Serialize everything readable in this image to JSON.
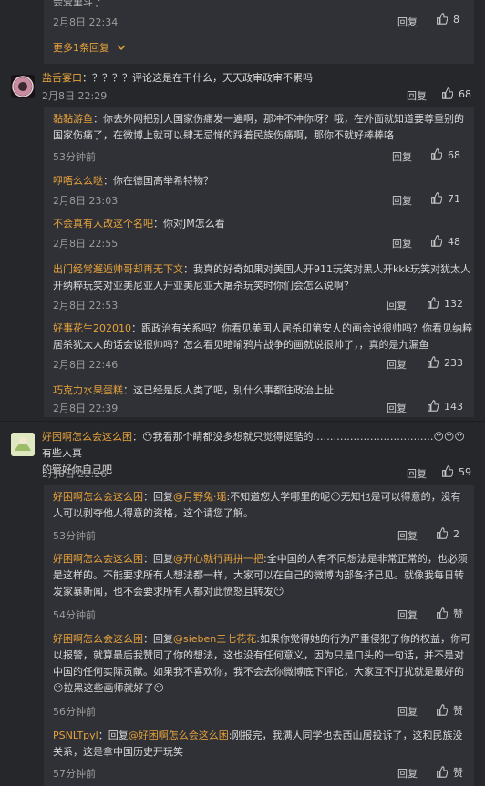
{
  "top": {
    "partial_text": "会爱里斗了",
    "time": "2月8日 22:34",
    "reply_label": "回复",
    "likes": "8",
    "more_replies": "更多1条回复"
  },
  "comment1": {
    "user": "盐舌宴口",
    "text": "：？？？？评论这是在干什么，天天政审政审不累吗",
    "time": "2月8日 22:29",
    "reply_label": "回复",
    "likes": "68",
    "replies": [
      {
        "user": "黏黏游鱼",
        "text1": "：你去外网把别人国家伤痛发一遍啊，那冲不冲你呀？哦，在外面就知道要尊重别的",
        "text2": "国家伤痛了，在微博上就可以肆无忌惮的踩着民族伤痛啊，那你不就好棒棒咯",
        "time": "53分钟前",
        "reply_label": "回复",
        "likes": "68"
      },
      {
        "user": "咿唔么么哒",
        "text1": "：你在德国高举希特物？",
        "time": "2月8日 23:03",
        "reply_label": "回复",
        "likes": "71"
      },
      {
        "user": "不会真有人改这个名吧",
        "text1": "：你对JM怎么看",
        "time": "2月8日 22:55",
        "reply_label": "回复",
        "likes": "48"
      },
      {
        "user": "出门经常邂逅帅哥却再无下文",
        "text1": "：我真的好奇如果对美国人开911玩笑对黑人开kkk玩笑对犹太人",
        "text2": "开纳粹玩笑对亚美尼亚人开亚美尼亚大屠杀玩笑时你们会怎么说啊？",
        "time": "2月8日 22:53",
        "reply_label": "回复",
        "likes": "132"
      },
      {
        "user": "好事花生202010",
        "text1": "：跟政治有关系吗？你看见美国人居杀印第安人的画会说很帅吗？你看见纳粹",
        "text2": "居杀犹太人的话会说很帅吗？怎么看见暗喻鸦片战争的画就说很帅了，，真的是九漏鱼",
        "time": "2月8日 22:46",
        "reply_label": "回复",
        "likes": "233"
      },
      {
        "user": "巧克力水果蛋糕",
        "text1": "：这已经是反人类了吧，别什么事都往政治上扯",
        "time": "2月8日 22:39",
        "reply_label": "回复",
        "likes": "143"
      }
    ]
  },
  "comment2": {
    "user": "好困啊怎么会这么困",
    "text1": "：😶我看那个睛都没多想就只觉得挺酷的………………………………😶😶😶 有些人真",
    "text2": "的管好你自己吧",
    "time": "2月8日 22:26",
    "reply_label": "回复",
    "likes": "59",
    "replies": [
      {
        "user": "好困啊怎么会这么困",
        "pre": "：回复",
        "mention": "@月野兔·瑶",
        "text1": ":不知道您大学哪里的呢😶无知也是可以得意的，没有",
        "text2": "人可以剥夺他人得意的资格，这个请您了解。",
        "time": "53分钟前",
        "reply_label": "回复",
        "likes": "2"
      },
      {
        "user": "好困啊怎么会这么困",
        "pre": "：回复",
        "mention": "@开心就行再拼一把",
        "text1": ":全中国的人有不同想法是非常正常的，也必须",
        "text2": "是这样的。不能要求所有人想法都一样，大家可以在自己的微博内部各抒己见。就像我每日转",
        "text3": "发家暴新闻，也不会要求所有人都对此愤怒且转发😶",
        "time": "54分钟前",
        "reply_label": "回复",
        "likes": "赞"
      },
      {
        "user": "好困啊怎么会这么困",
        "pre": "：回复",
        "mention": "@sieben三七花花",
        "text1": ":如果你觉得她的行为严重侵犯了你的权益，你可",
        "text2": "以报警，就算最后我赞同了你的想法，这也没有任何意义，因为只是口头的一句话，并不是对",
        "text3": "中国的任何实际贡献。如果我不喜欢你，我不会去你微博底下评论，大家互不打扰就是最好的",
        "text4": "😶拉黑这些画师就好了😶",
        "time": "56分钟前",
        "reply_label": "回复",
        "likes": "赞"
      },
      {
        "user": "PSNLTpyl",
        "pre": "：回复",
        "mention": "@好困啊怎么会这么困",
        "text1": ":刚报完，我满人同学也去西山居投诉了，这和民族没",
        "text2": "关系，这是拿中国历史开玩笑",
        "time": "57分钟前",
        "reply_label": "回复",
        "likes": "赞"
      }
    ]
  },
  "colors": {
    "background": "#26272b",
    "reply_block": "#303136",
    "username": "#e6a23c",
    "text": "#d9d9d9",
    "meta": "#9c9c9c"
  },
  "icons": {
    "like": "thumb-up-icon",
    "expand": "chevron-down-icon"
  }
}
